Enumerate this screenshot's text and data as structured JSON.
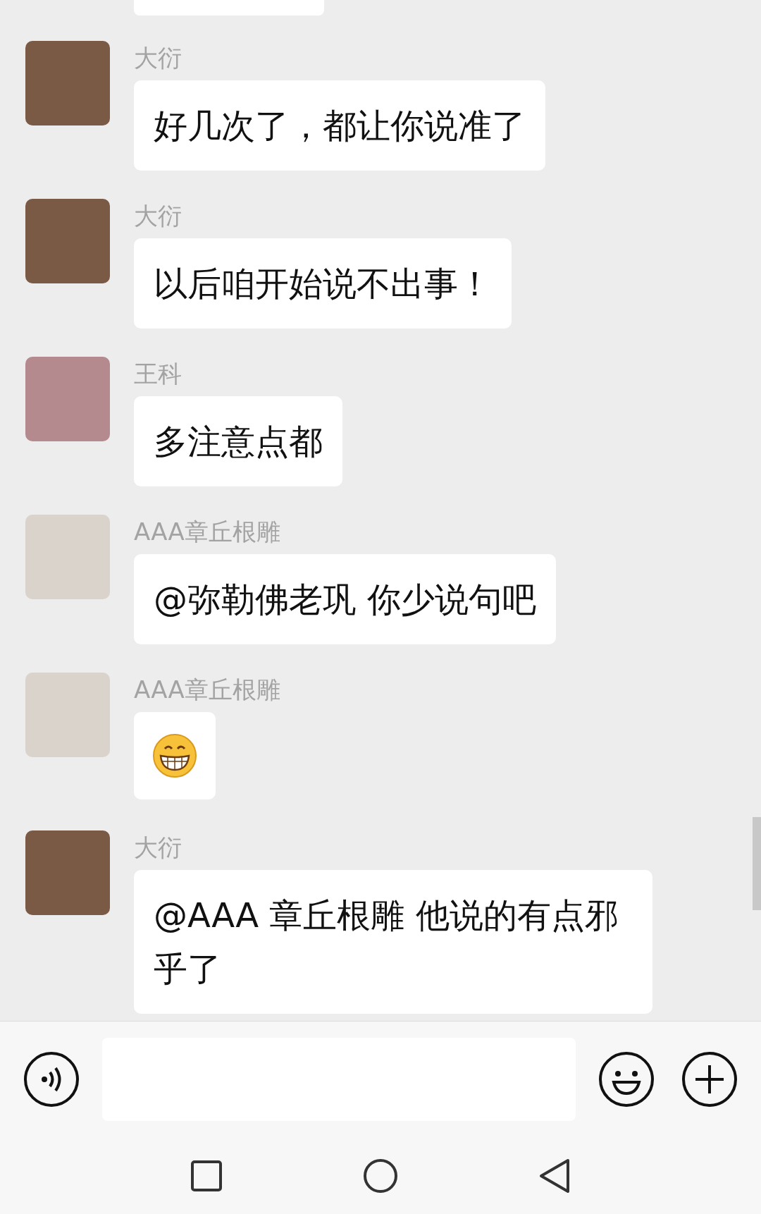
{
  "messages": [
    {
      "sender": "大衍",
      "kind": "text",
      "text": "好几次了，都让你说准了"
    },
    {
      "sender": "大衍",
      "kind": "text",
      "text": "以后咱开始说不出事！"
    },
    {
      "sender": "王科",
      "kind": "text",
      "text": "多注意点都"
    },
    {
      "sender": "AAA章丘根雕",
      "kind": "text",
      "text": "@弥勒佛老巩  你少说句吧"
    },
    {
      "sender": "AAA章丘根雕",
      "kind": "emoji"
    },
    {
      "sender": "大衍",
      "kind": "text",
      "text": "@AAA 章丘根雕  他说的有点邪乎了"
    }
  ]
}
